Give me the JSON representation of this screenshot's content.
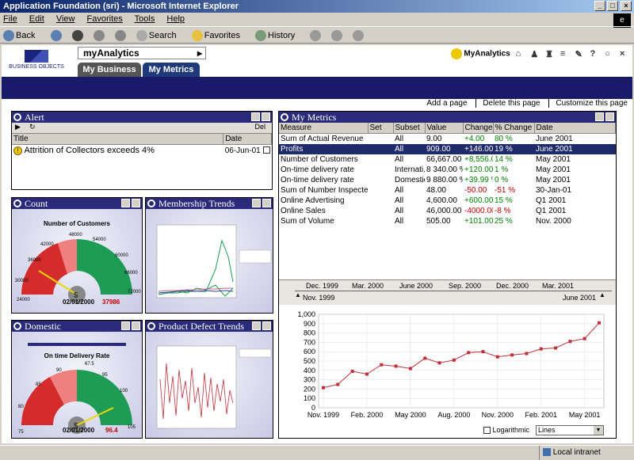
{
  "window": {
    "title": "Application Foundation (sri) - Microsoft Internet Explorer"
  },
  "menu": [
    "File",
    "Edit",
    "View",
    "Favorites",
    "Tools",
    "Help"
  ],
  "toolbar": {
    "back": "Back",
    "search": "Search",
    "favorites": "Favorites",
    "history": "History"
  },
  "app": {
    "name": "myAnalytics",
    "logo_text": "BUSINESS OBJECTS",
    "brand": "MyAnalytics",
    "tabs": [
      "My Business",
      "My Metrics"
    ]
  },
  "page_links": [
    "Add a page",
    "Delete this page",
    "Customize this page"
  ],
  "alert": {
    "title": "Alert",
    "del": "Del",
    "cols": [
      "Title",
      "Date"
    ],
    "rows": [
      {
        "title": "Attrition of Collectors exceeds 4%",
        "date": "06-Jun-01"
      }
    ]
  },
  "count": {
    "title": "Count",
    "gauge_title": "Number of Customers",
    "ticks": [
      "24000",
      "30000",
      "36000",
      "42000",
      "48000",
      "54000",
      "60000",
      "66000",
      "72000"
    ],
    "date": "02/01/2000",
    "value": "37986"
  },
  "domestic": {
    "title": "Domestic",
    "gauge_title": "On time Delivery Rate",
    "ticks": [
      "75",
      "80",
      "85",
      "90",
      "67.5",
      "95",
      "100",
      "105"
    ],
    "date": "02/01/2000",
    "value": "96.4"
  },
  "membership": {
    "title": "Membership Trends"
  },
  "defects": {
    "title": "Product Defect Trends"
  },
  "metrics": {
    "title": "My Metrics",
    "cols": [
      "Measure",
      "Set",
      "Subset",
      "Value",
      "Change",
      "% Change",
      "Date"
    ],
    "rows": [
      {
        "measure": "Sum of Actual Revenue",
        "set": "",
        "subset": "All",
        "value": "9.00",
        "change": "+4.00",
        "pct": "80 %",
        "date": "June 2001"
      },
      {
        "measure": "Profits",
        "set": "",
        "subset": "All",
        "value": "909.00",
        "change": "+146.00",
        "pct": "19 %",
        "date": "June 2001"
      },
      {
        "measure": "Number of Customers",
        "set": "",
        "subset": "All",
        "value": "66,667.00",
        "change": "+8,556.00",
        "pct": "14 %",
        "date": "May 2001"
      },
      {
        "measure": "On-time delivery rate",
        "set": "",
        "subset": "Internati..",
        "value": "8 340.00 %",
        "change": "+120.00 ..",
        "pct": "1 %",
        "date": "May 2001"
      },
      {
        "measure": "On-time delivery rate",
        "set": "",
        "subset": "Domestic",
        "value": "9 880.00 %",
        "change": "+39.99 %",
        "pct": "0 %",
        "date": "May 2001"
      },
      {
        "measure": "Sum of Number Inspected",
        "set": "",
        "subset": "All",
        "value": "48.00",
        "change": "-50.00",
        "pct": "-51 %",
        "date": "30-Jan-01"
      },
      {
        "measure": "Online Advertising",
        "set": "",
        "subset": "All",
        "value": "4,600.00",
        "change": "+600.00",
        "pct": "15 %",
        "date": "Q1 2001"
      },
      {
        "measure": "Online Sales",
        "set": "",
        "subset": "All",
        "value": "46,000.00",
        "change": "-4000.00",
        "pct": "-8 %",
        "date": "Q1 2001"
      },
      {
        "measure": "Sum of Volume",
        "set": "",
        "subset": "All",
        "value": "505.00",
        "change": "+101.00",
        "pct": "25 %",
        "date": "Nov. 2000"
      }
    ],
    "timeline": [
      "Dec. 1999",
      "Mar. 2000",
      "June 2000",
      "Sep. 2000",
      "Dec. 2000",
      "Mar. 2001"
    ],
    "range_start": "Nov. 1999",
    "range_end": "June 2001",
    "logarithmic": "Logarithmic",
    "chart_style": "Lines"
  },
  "chart_data": {
    "type": "line",
    "x": [
      "Nov. 1999",
      "Dec. 1999",
      "Jan. 2000",
      "Feb. 2000",
      "Mar. 2000",
      "Apr. 2000",
      "May 2000",
      "Jun. 2000",
      "Jul. 2000",
      "Aug. 2000",
      "Sep. 2000",
      "Oct. 2000",
      "Nov. 2000",
      "Dec. 2000",
      "Jan. 2001",
      "Feb. 2001",
      "Mar. 2001",
      "Apr. 2001",
      "May 2001",
      "June 2001"
    ],
    "values": [
      215,
      250,
      390,
      360,
      460,
      445,
      420,
      530,
      480,
      510,
      590,
      600,
      545,
      565,
      580,
      630,
      640,
      710,
      740,
      909
    ],
    "xticks": [
      "Nov. 1999",
      "Feb. 2000",
      "May 2000",
      "Aug. 2000",
      "Nov. 2000",
      "Feb. 2001",
      "May 2001"
    ],
    "yticks": [
      "0",
      "100",
      "200",
      "300",
      "400",
      "500",
      "600",
      "700",
      "800",
      "900",
      "1,000"
    ],
    "ylim": [
      0,
      1000
    ],
    "color": "#c0303a"
  },
  "status": {
    "zone": "Local intranet"
  }
}
